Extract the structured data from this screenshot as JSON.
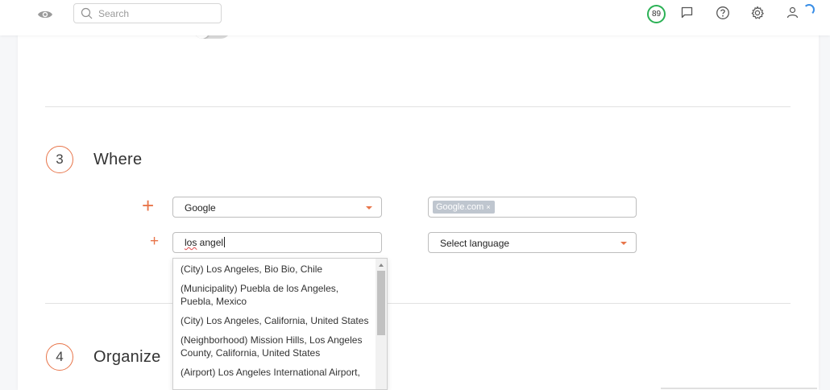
{
  "header": {
    "search_placeholder": "Search",
    "score": "89",
    "icons": [
      "eye-icon",
      "search-icon",
      "chat-icon",
      "help-icon",
      "settings-icon",
      "user-icon",
      "loading-spinner"
    ]
  },
  "steps": [
    {
      "number": "3",
      "title": "Where"
    },
    {
      "number": "4",
      "title": "Organize"
    }
  ],
  "where": {
    "row1": {
      "search_engine": "Google",
      "domain_tag": "Google.com",
      "tag_remove": "×"
    },
    "row2": {
      "location_input_typed": "los",
      "location_input_rest": " angel",
      "language_placeholder": "Select language"
    }
  },
  "location_suggestions": [
    "(City) Los Angeles, Bio Bio, Chile",
    "(Municipality) Puebla de los Angeles, Puebla, Mexico",
    "(City) Los Angeles, California, United States",
    "(Neighborhood) Mission Hills, Los Angeles County, California, United States",
    "(Airport) Los Angeles International Airport,"
  ],
  "colors": {
    "accent": "#e8754a",
    "score_ring": "#2bb155",
    "tag_bg": "#bfc6cf"
  }
}
